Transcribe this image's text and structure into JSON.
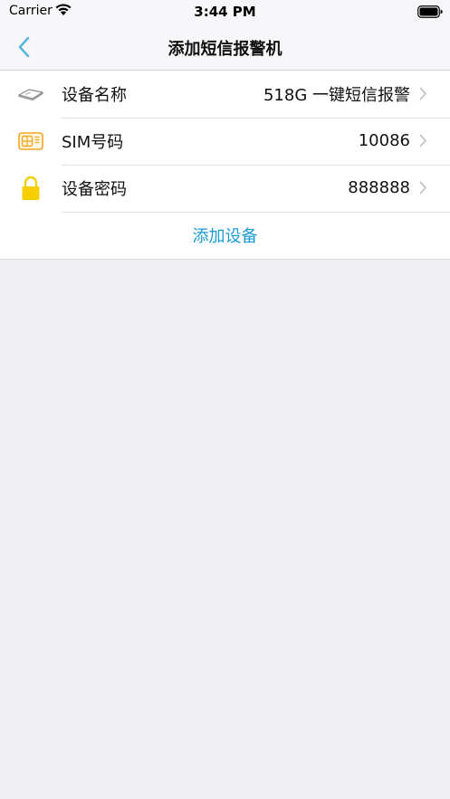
{
  "status_bar": {
    "carrier": "Carrier",
    "time": "3:44 PM"
  },
  "nav": {
    "title": "添加短信报警机",
    "accent_color": "#5ab7e0"
  },
  "form": {
    "rows": [
      {
        "icon": "device-icon",
        "label": "设备名称",
        "value": "518G 一键短信报警"
      },
      {
        "icon": "sim-card-icon",
        "label": "SIM号码",
        "value": "10086"
      },
      {
        "icon": "lock-icon",
        "label": "设备密码",
        "value": "888888"
      }
    ],
    "add_label": "添加设备",
    "add_color": "#1b9bd8"
  }
}
